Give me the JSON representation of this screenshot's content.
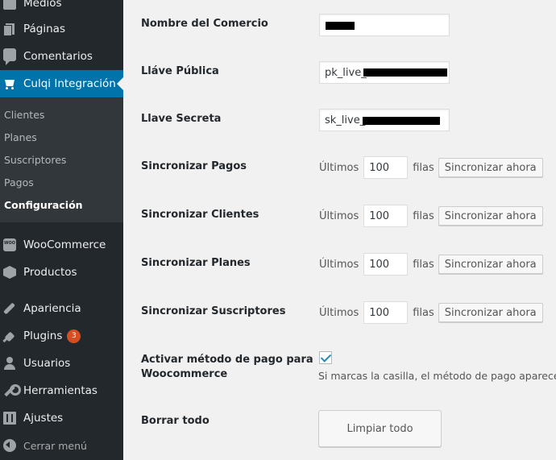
{
  "sidebar": {
    "medios": "Medios",
    "paginas": "Páginas",
    "comentarios": "Comentarios",
    "culqi": "Culqi Integración",
    "submenu": [
      "Clientes",
      "Planes",
      "Suscriptores",
      "Pagos",
      "Configuración"
    ],
    "woocommerce": "WooCommerce",
    "productos": "Productos",
    "apariencia": "Apariencia",
    "plugins": "Plugins",
    "plugins_badge": "3",
    "usuarios": "Usuarios",
    "herramientas": "Herramientas",
    "ajustes": "Ajustes",
    "cerrar": "Cerrar menú"
  },
  "form": {
    "nombre_label": "Nombre del Comercio",
    "publica_label": "Lláve Pública",
    "publica_value": "pk_live_",
    "secreta_label": "Llave Secreta",
    "secreta_value": "sk_live_",
    "sync_rows": [
      {
        "label": "Sincronizar Pagos",
        "prefix": "Últimos",
        "value": "100",
        "suffix": "filas",
        "button": "Sincronizar ahora"
      },
      {
        "label": "Sincronizar Clientes",
        "prefix": "Últimos",
        "value": "100",
        "suffix": "filas",
        "button": "Sincronizar ahora"
      },
      {
        "label": "Sincronizar Planes",
        "prefix": "Últimos",
        "value": "100",
        "suffix": "filas",
        "button": "Sincronizar ahora"
      },
      {
        "label": "Sincronizar Suscriptores",
        "prefix": "Últimos",
        "value": "100",
        "suffix": "filas",
        "button": "Sincronizar ahora"
      }
    ],
    "activar_label_1": "Activar método de pago para",
    "activar_label_2": "Woocommerce",
    "activar_desc": "Si marcas la casilla, el método de pago aparecer",
    "borrar_label": "Borrar todo",
    "borrar_button": "Limpiar todo"
  },
  "colors": {
    "sidebar_bg": "#23282d",
    "accent": "#0073aa",
    "badge": "#d54e21"
  }
}
